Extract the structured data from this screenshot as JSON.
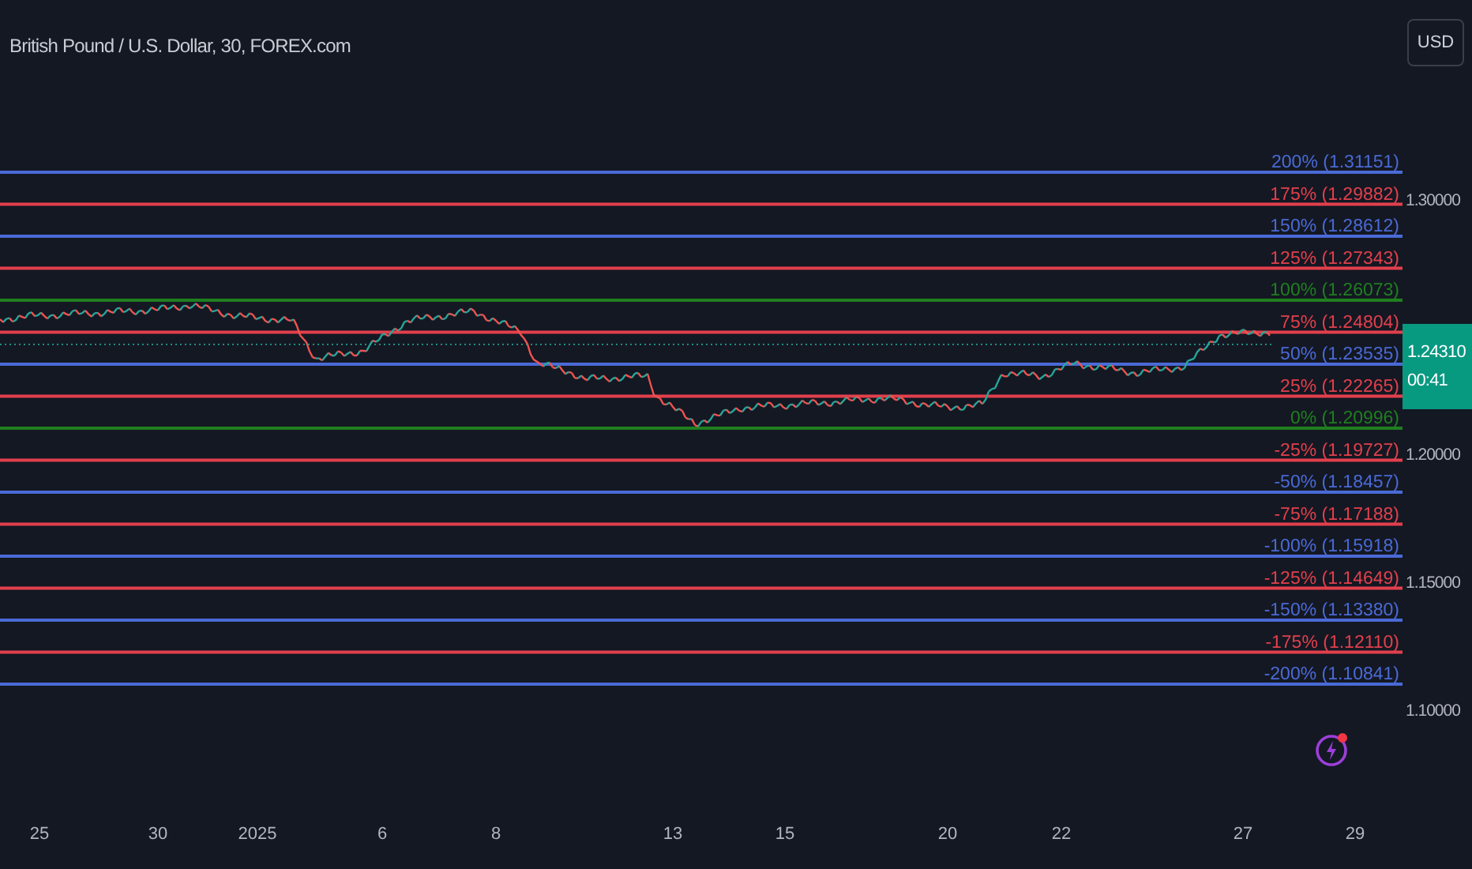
{
  "title": "British Pound / U.S. Dollar, 30, FOREX.com",
  "currency_button": "USD",
  "levels": [
    {
      "label": "200% (1.31151)",
      "color": "#4a6ad6"
    },
    {
      "label": "175% (1.29882)",
      "color": "#e2404c"
    },
    {
      "label": "150% (1.28612)",
      "color": "#4a6ad6"
    },
    {
      "label": "125% (1.27343)",
      "color": "#e2404c"
    },
    {
      "label": "100% (1.26073)",
      "color": "#1f7f1f"
    },
    {
      "label": "75% (1.24804)",
      "color": "#e2404c"
    },
    {
      "label": "50% (1.23535)",
      "color": "#4a6ad6"
    },
    {
      "label": "25% (1.22265)",
      "color": "#e2404c"
    },
    {
      "label": "0% (1.20996)",
      "color": "#1f7f1f"
    },
    {
      "label": "-25% (1.19727)",
      "color": "#e2404c"
    },
    {
      "label": "-50% (1.18457)",
      "color": "#4a6ad6"
    },
    {
      "label": "-75% (1.17188)",
      "color": "#e2404c"
    },
    {
      "label": "-100% (1.15918)",
      "color": "#4a6ad6"
    },
    {
      "label": "-125% (1.14649)",
      "color": "#e2404c"
    },
    {
      "label": "-150% (1.13380)",
      "color": "#4a6ad6"
    },
    {
      "label": "-175% (1.12110)",
      "color": "#e2404c"
    },
    {
      "label": "-200% (1.10841)",
      "color": "#4a6ad6"
    }
  ],
  "price_axis": [
    "1.30000",
    "1.20000",
    "1.15000",
    "1.10000"
  ],
  "current_price": {
    "price": "1.24310",
    "countdown": "00:41"
  },
  "time_axis": [
    "25",
    "30",
    "2025",
    "6",
    "8",
    "13",
    "15",
    "20",
    "22",
    "27",
    "29"
  ]
}
